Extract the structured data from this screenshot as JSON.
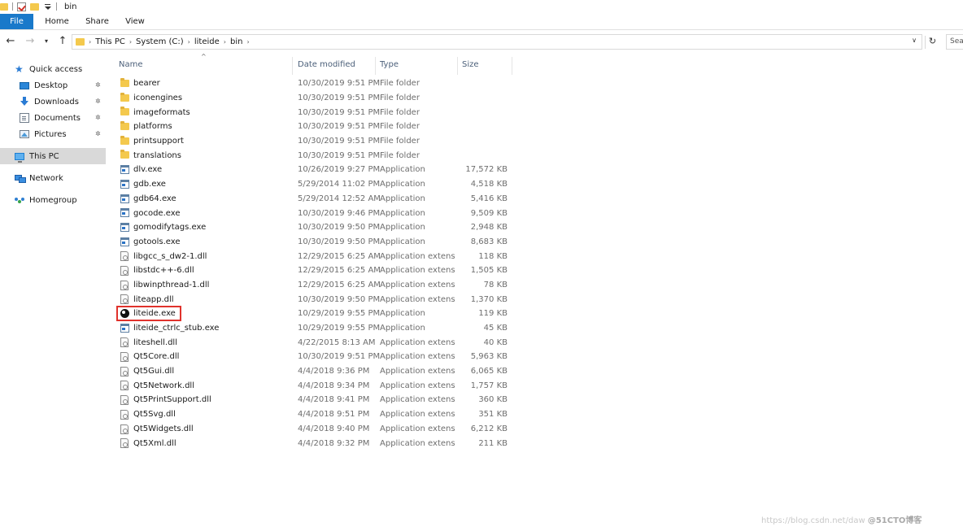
{
  "window": {
    "title": "bin"
  },
  "ribbon": {
    "tabs": [
      "File",
      "Home",
      "Share",
      "View"
    ]
  },
  "address": {
    "crumbs": [
      "This PC",
      "System (C:)",
      "liteide",
      "bin"
    ],
    "search_placeholder": "Sea"
  },
  "nav": {
    "items": [
      {
        "label": "Quick access",
        "icon": "star-icon"
      },
      {
        "label": "Desktop",
        "icon": "desktop-icon",
        "pinned": true
      },
      {
        "label": "Downloads",
        "icon": "download-icon",
        "pinned": true
      },
      {
        "label": "Documents",
        "icon": "documents-icon",
        "pinned": true
      },
      {
        "label": "Pictures",
        "icon": "pictures-icon",
        "pinned": true
      },
      {
        "label": "This PC",
        "icon": "computer-icon",
        "selected": true
      },
      {
        "label": "Network",
        "icon": "network-icon"
      },
      {
        "label": "Homegroup",
        "icon": "homegroup-icon"
      }
    ]
  },
  "columns": {
    "name": "Name",
    "date": "Date modified",
    "type": "Type",
    "size": "Size"
  },
  "files": [
    {
      "name": "bearer",
      "date": "10/30/2019 9:51 PM",
      "type": "File folder",
      "size": "",
      "kind": "folder"
    },
    {
      "name": "iconengines",
      "date": "10/30/2019 9:51 PM",
      "type": "File folder",
      "size": "",
      "kind": "folder"
    },
    {
      "name": "imageformats",
      "date": "10/30/2019 9:51 PM",
      "type": "File folder",
      "size": "",
      "kind": "folder"
    },
    {
      "name": "platforms",
      "date": "10/30/2019 9:51 PM",
      "type": "File folder",
      "size": "",
      "kind": "folder"
    },
    {
      "name": "printsupport",
      "date": "10/30/2019 9:51 PM",
      "type": "File folder",
      "size": "",
      "kind": "folder"
    },
    {
      "name": "translations",
      "date": "10/30/2019 9:51 PM",
      "type": "File folder",
      "size": "",
      "kind": "folder"
    },
    {
      "name": "dlv.exe",
      "date": "10/26/2019 9:27 PM",
      "type": "Application",
      "size": "17,572 KB",
      "kind": "app"
    },
    {
      "name": "gdb.exe",
      "date": "5/29/2014 11:02 PM",
      "type": "Application",
      "size": "4,518 KB",
      "kind": "app"
    },
    {
      "name": "gdb64.exe",
      "date": "5/29/2014 12:52 AM",
      "type": "Application",
      "size": "5,416 KB",
      "kind": "app"
    },
    {
      "name": "gocode.exe",
      "date": "10/30/2019 9:46 PM",
      "type": "Application",
      "size": "9,509 KB",
      "kind": "app"
    },
    {
      "name": "gomodifytags.exe",
      "date": "10/30/2019 9:50 PM",
      "type": "Application",
      "size": "2,948 KB",
      "kind": "app"
    },
    {
      "name": "gotools.exe",
      "date": "10/30/2019 9:50 PM",
      "type": "Application",
      "size": "8,683 KB",
      "kind": "app"
    },
    {
      "name": "libgcc_s_dw2-1.dll",
      "date": "12/29/2015 6:25 AM",
      "type": "Application extens...",
      "size": "118 KB",
      "kind": "dll"
    },
    {
      "name": "libstdc++-6.dll",
      "date": "12/29/2015 6:25 AM",
      "type": "Application extens...",
      "size": "1,505 KB",
      "kind": "dll"
    },
    {
      "name": "libwinpthread-1.dll",
      "date": "12/29/2015 6:25 AM",
      "type": "Application extens...",
      "size": "78 KB",
      "kind": "dll"
    },
    {
      "name": "liteapp.dll",
      "date": "10/30/2019 9:50 PM",
      "type": "Application extens...",
      "size": "1,370 KB",
      "kind": "dll"
    },
    {
      "name": "liteide.exe",
      "date": "10/29/2019 9:55 PM",
      "type": "Application",
      "size": "119 KB",
      "kind": "lite",
      "highlighted": true
    },
    {
      "name": "liteide_ctrlc_stub.exe",
      "date": "10/29/2019 9:55 PM",
      "type": "Application",
      "size": "45 KB",
      "kind": "app"
    },
    {
      "name": "liteshell.dll",
      "date": "4/22/2015 8:13 AM",
      "type": "Application extens...",
      "size": "40 KB",
      "kind": "dll"
    },
    {
      "name": "Qt5Core.dll",
      "date": "10/30/2019 9:51 PM",
      "type": "Application extens...",
      "size": "5,963 KB",
      "kind": "dll"
    },
    {
      "name": "Qt5Gui.dll",
      "date": "4/4/2018 9:36 PM",
      "type": "Application extens...",
      "size": "6,065 KB",
      "kind": "dll"
    },
    {
      "name": "Qt5Network.dll",
      "date": "4/4/2018 9:34 PM",
      "type": "Application extens...",
      "size": "1,757 KB",
      "kind": "dll"
    },
    {
      "name": "Qt5PrintSupport.dll",
      "date": "4/4/2018 9:41 PM",
      "type": "Application extens...",
      "size": "360 KB",
      "kind": "dll"
    },
    {
      "name": "Qt5Svg.dll",
      "date": "4/4/2018 9:51 PM",
      "type": "Application extens...",
      "size": "351 KB",
      "kind": "dll"
    },
    {
      "name": "Qt5Widgets.dll",
      "date": "4/4/2018 9:40 PM",
      "type": "Application extens...",
      "size": "6,212 KB",
      "kind": "dll"
    },
    {
      "name": "Qt5Xml.dll",
      "date": "4/4/2018 9:32 PM",
      "type": "Application extens...",
      "size": "211 KB",
      "kind": "dll"
    }
  ],
  "watermark": {
    "url": "https://blog.csdn.net/daw",
    "brand": "@51CTO博客"
  },
  "colors": {
    "file_tab": "#1979ca",
    "selected_nav": "#d9d9d9",
    "highlight_box": "#e0322c",
    "folder": "#f4c94d"
  }
}
